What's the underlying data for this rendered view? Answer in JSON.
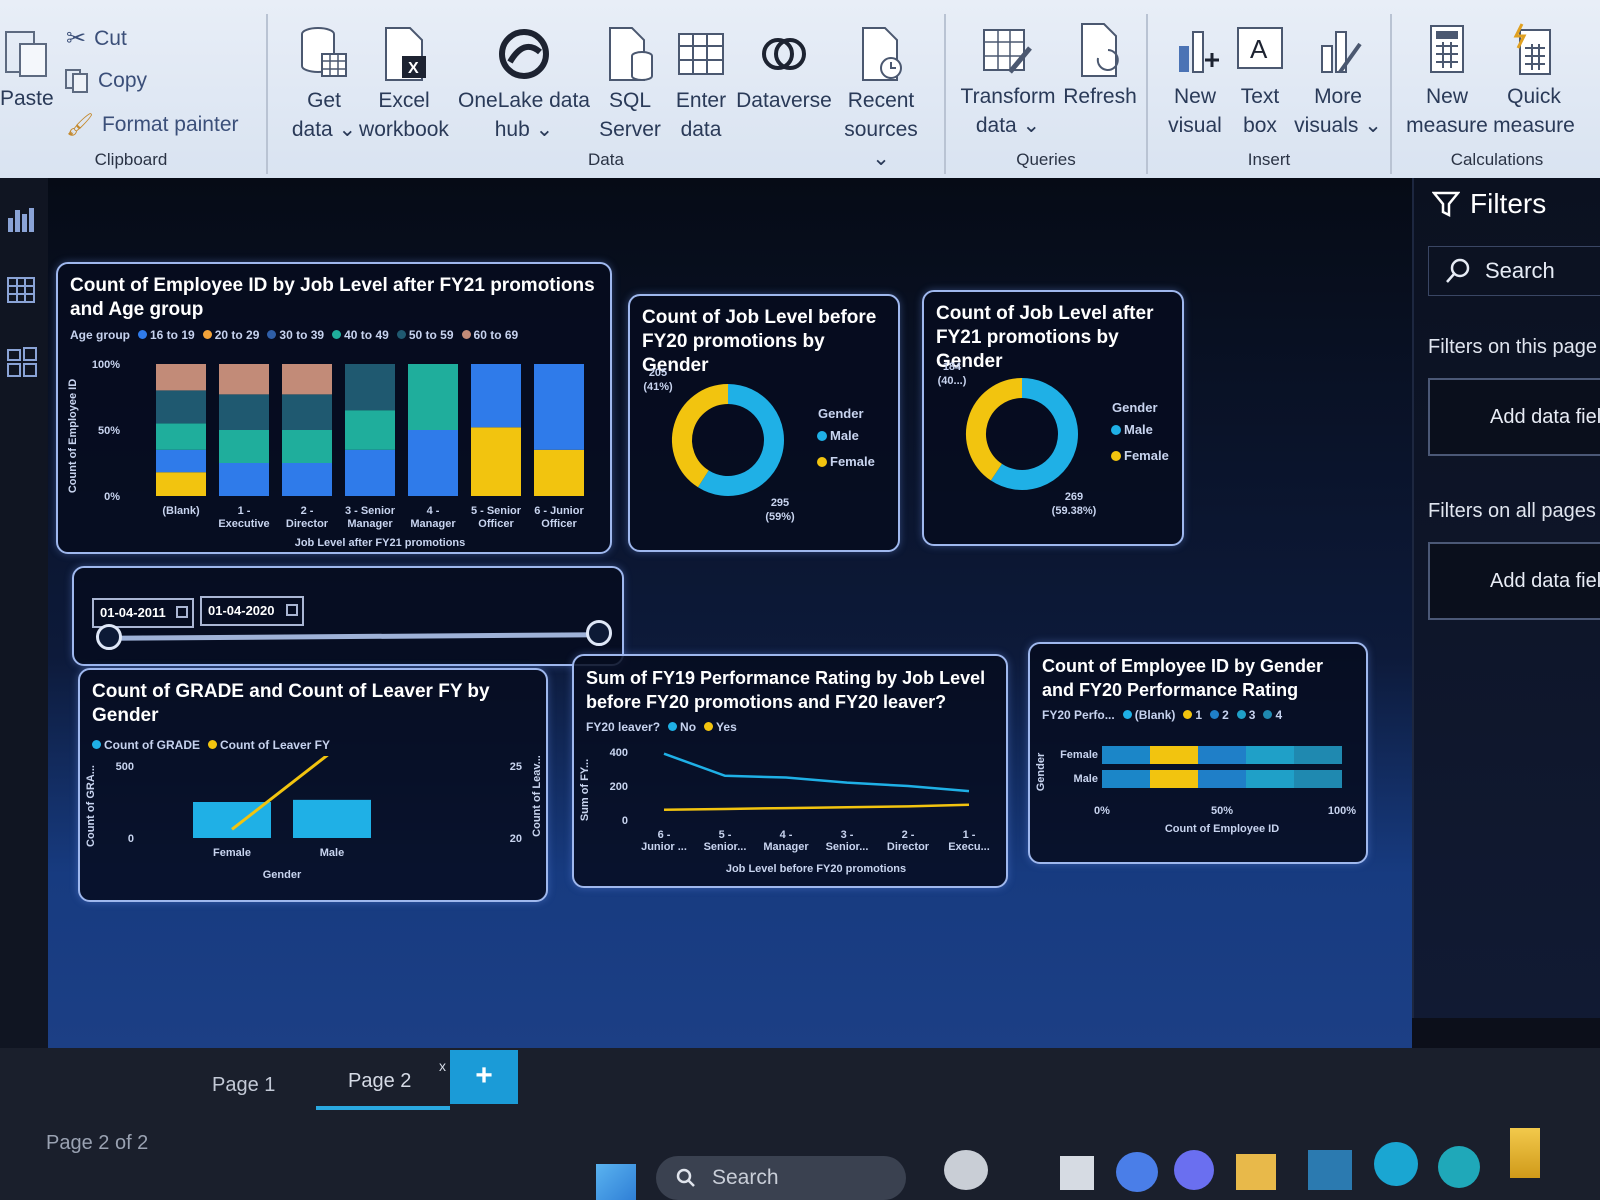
{
  "ribbon": {
    "clipboard": {
      "paste": "Paste",
      "cut": "Cut",
      "copy": "Copy",
      "format_painter": "Format painter",
      "label": "Clipboard"
    },
    "data": {
      "label": "Data",
      "get_data": [
        "Get",
        "data"
      ],
      "excel": [
        "Excel",
        "workbook"
      ],
      "onelake": [
        "OneLake data",
        "hub"
      ],
      "sql": [
        "SQL",
        "Server"
      ],
      "enter": [
        "Enter",
        "data"
      ],
      "dataverse": [
        "Dataverse",
        ""
      ],
      "recent": [
        "Recent",
        "sources"
      ]
    },
    "queries": {
      "label": "Queries",
      "transform": [
        "Transform",
        "data"
      ],
      "refresh": [
        "Refresh",
        ""
      ]
    },
    "insert": {
      "label": "Insert",
      "new_visual": [
        "New",
        "visual"
      ],
      "text_box": [
        "Text",
        "box"
      ],
      "more_visuals": [
        "More",
        "visuals"
      ]
    },
    "calculations": {
      "label": "Calculations",
      "new_measure": [
        "New",
        "measure"
      ],
      "quick_measure": [
        "Quick",
        "measure"
      ]
    }
  },
  "filters": {
    "title": "Filters",
    "search_placeholder": "Search",
    "on_this_page": "Filters on this page",
    "add_field_1": "Add data fiel",
    "on_all_pages": "Filters on all pages",
    "add_field_2": "Add data field"
  },
  "slicer": {
    "start": "01-04-2011",
    "end": "01-04-2020"
  },
  "tabs": {
    "page1": "Page 1",
    "page2": "Page 2",
    "add": "+",
    "status": "Page 2 of 2",
    "close": "x"
  },
  "taskbar": {
    "search": "Search"
  },
  "colors": {
    "age_16_19": "#2f7bea",
    "age_20_29": "#f2a33a",
    "age_30_39": "#2f5fa8",
    "age_40_49": "#1fae9c",
    "age_50_59": "#1f5970",
    "age_60_69": "#c28b78",
    "male": "#1fb0e6",
    "female": "#f2c40f",
    "blank": "#1b86c8"
  },
  "chart_data": [
    {
      "type": "bar",
      "title": "Count of Employee ID by Job Level after FY21 promotions and Age group",
      "legend_title": "Age group",
      "xlabel": "Job Level after FY21 promotions",
      "ylabel": "Count of Employee ID",
      "y_ticks": [
        "100%",
        "50%",
        "0%"
      ],
      "categories": [
        [
          "(Blank)"
        ],
        [
          "1 -",
          "Executive"
        ],
        [
          "2 -",
          "Director"
        ],
        [
          "3 - Senior",
          "Manager"
        ],
        [
          "4 -",
          "Manager"
        ],
        [
          "5 - Senior",
          "Officer"
        ],
        [
          "6 - Junior",
          "Officer"
        ]
      ],
      "series": [
        {
          "name": "16 to 19",
          "color": "#f2c40f",
          "values": [
            0.18,
            0,
            0,
            0,
            0,
            0.52,
            0.35
          ]
        },
        {
          "name": "20 to 29",
          "color": "#2f7bea",
          "values": [
            0.17,
            0.25,
            0.25,
            0.35,
            0.5,
            0.48,
            0.65
          ]
        },
        {
          "name": "30 to 39",
          "color": "#1fae9c",
          "values": [
            0.2,
            0.25,
            0.25,
            0.3,
            0.5,
            0,
            0
          ]
        },
        {
          "name": "40 to 49",
          "color": "#1f5970",
          "values": [
            0.25,
            0.27,
            0.27,
            0.35,
            0,
            0,
            0
          ]
        },
        {
          "name": "50 to 59",
          "color": "#c28b78",
          "values": [
            0.2,
            0.23,
            0.23,
            0,
            0,
            0,
            0
          ]
        }
      ],
      "legend": [
        {
          "name": "16 to 19",
          "color": "#2f7bea"
        },
        {
          "name": "20 to 29",
          "color": "#f2a33a"
        },
        {
          "name": "30 to 39",
          "color": "#2f5fa8"
        },
        {
          "name": "40 to 49",
          "color": "#1fae9c"
        },
        {
          "name": "50 to 59",
          "color": "#1f5970"
        },
        {
          "name": "60 to 69",
          "color": "#c28b78"
        }
      ]
    },
    {
      "type": "pie",
      "title": "Count of Job Level before FY20 promotions by Gender",
      "legend_title": "Gender",
      "slices": [
        {
          "name": "Male",
          "value": 295,
          "label": [
            "295",
            "(59%)"
          ]
        },
        {
          "name": "Female",
          "value": 205,
          "label": [
            "205",
            "(41%)"
          ]
        }
      ]
    },
    {
      "type": "pie",
      "title": "Count of Job Level after FY21 promotions by Gender",
      "legend_title": "Gender",
      "slices": [
        {
          "name": "Male",
          "value": 269,
          "label": [
            "269",
            "(59.38%)"
          ]
        },
        {
          "name": "Female",
          "value": 184,
          "label": [
            "184",
            "(40...)"
          ]
        }
      ]
    },
    {
      "type": "bar",
      "title": "Count of GRADE and Count of Leaver FY by Gender",
      "legend": [
        "Count of GRADE",
        "Count of Leaver FY"
      ],
      "categories": [
        "Female",
        "Male"
      ],
      "bar_values": [
        250,
        265
      ],
      "line_values": [
        20.5,
        25
      ],
      "xlabel": "Gender",
      "ylabel": "Count of GRA...",
      "y2label": "Count of Leav...",
      "y_ticks": [
        "500",
        "0"
      ],
      "y2_ticks": [
        "25",
        "20"
      ],
      "ylim": [
        0,
        500
      ],
      "y2lim": [
        20,
        25
      ]
    },
    {
      "type": "line",
      "title": "Sum of FY19 Performance Rating by Job Level before FY20 promotions and FY20 leaver?",
      "legend_title": "FY20 leaver?",
      "categories": [
        [
          "6 -",
          "Junior ..."
        ],
        [
          "5 -",
          "Senior..."
        ],
        [
          "4 -",
          "Manager"
        ],
        [
          "3 -",
          "Senior..."
        ],
        [
          "2 -",
          "Director"
        ],
        [
          "1 -",
          "Execu..."
        ]
      ],
      "series": [
        {
          "name": "No",
          "values": [
            390,
            260,
            250,
            220,
            200,
            170
          ]
        },
        {
          "name": "Yes",
          "values": [
            60,
            65,
            70,
            75,
            80,
            90
          ]
        }
      ],
      "xlabel": "Job Level before FY20 promotions",
      "ylabel": "Sum of FY...",
      "y_ticks": [
        "400",
        "200",
        "0"
      ],
      "ylim": [
        0,
        400
      ]
    },
    {
      "type": "bar",
      "title": "Count of Employee ID by Gender and FY20 Performance Rating",
      "legend_title": "FY20 Perfo...",
      "categories": [
        "Female",
        "Male"
      ],
      "series": [
        {
          "name": "(Blank)",
          "values": [
            0.2,
            0.2
          ]
        },
        {
          "name": "1",
          "values": [
            0.2,
            0.2
          ]
        },
        {
          "name": "2",
          "values": [
            0.2,
            0.2
          ]
        },
        {
          "name": "3",
          "values": [
            0.2,
            0.2
          ]
        },
        {
          "name": "4",
          "values": [
            0.2,
            0.2
          ]
        }
      ],
      "xlabel": "Count of Employee ID",
      "ylabel": "Gender",
      "x_ticks": [
        "0%",
        "50%",
        "100%"
      ]
    }
  ]
}
